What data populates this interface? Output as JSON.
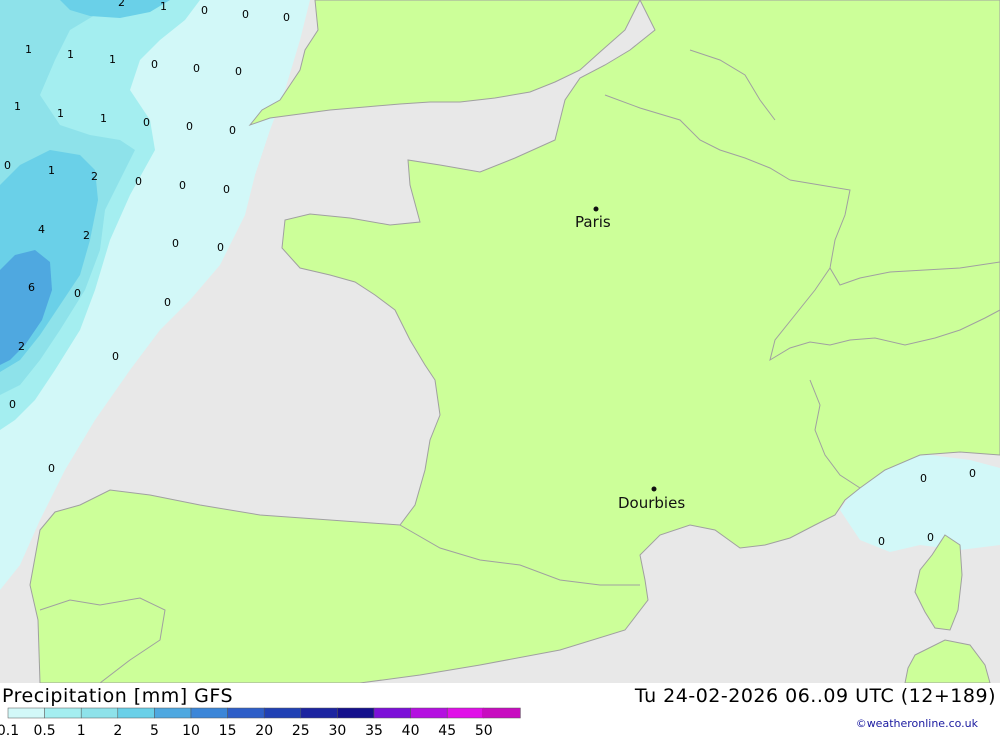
{
  "map": {
    "colors": {
      "sea": "#e8e8e8",
      "land": "#ccff99",
      "border": "#a0a0a0",
      "precip_01": "#d2f8f8",
      "precip_05": "#a4eef0",
      "precip_1": "#8ee2ea",
      "precip_2": "#6ad0e8",
      "precip_5": "#4fa8e0"
    },
    "cities": [
      {
        "name": "Paris"
      },
      {
        "name": "Dourbies"
      }
    ],
    "precip_values": [
      "2",
      "1",
      "0",
      "0",
      "0",
      "1",
      "1",
      "1",
      "0",
      "0",
      "0",
      "1",
      "1",
      "1",
      "0",
      "0",
      "0",
      "0",
      "1",
      "2",
      "0",
      "0",
      "0",
      "4",
      "2",
      "0",
      "0",
      "6",
      "0",
      "0",
      "2",
      "0",
      "0",
      "0",
      "0",
      "0",
      "0",
      "0"
    ]
  },
  "footer": {
    "title": "Precipitation [mm] GFS",
    "datetime": "Tu 24-02-2026 06..09 UTC (12+189)",
    "credit": "©weatheronline.co.uk",
    "legend": {
      "ticks": [
        "0.1",
        "0.5",
        "1",
        "2",
        "5",
        "10",
        "15",
        "20",
        "25",
        "30",
        "35",
        "40",
        "45",
        "50"
      ],
      "colors": [
        "#d2f8f8",
        "#a4eef0",
        "#8ee2ea",
        "#6ad0e8",
        "#4fa8e0",
        "#3c86d8",
        "#2e5ec8",
        "#2040b4",
        "#1c24a0",
        "#14108c",
        "#7c10d8",
        "#b410e0",
        "#e010e8",
        "#c80cc0"
      ]
    }
  }
}
